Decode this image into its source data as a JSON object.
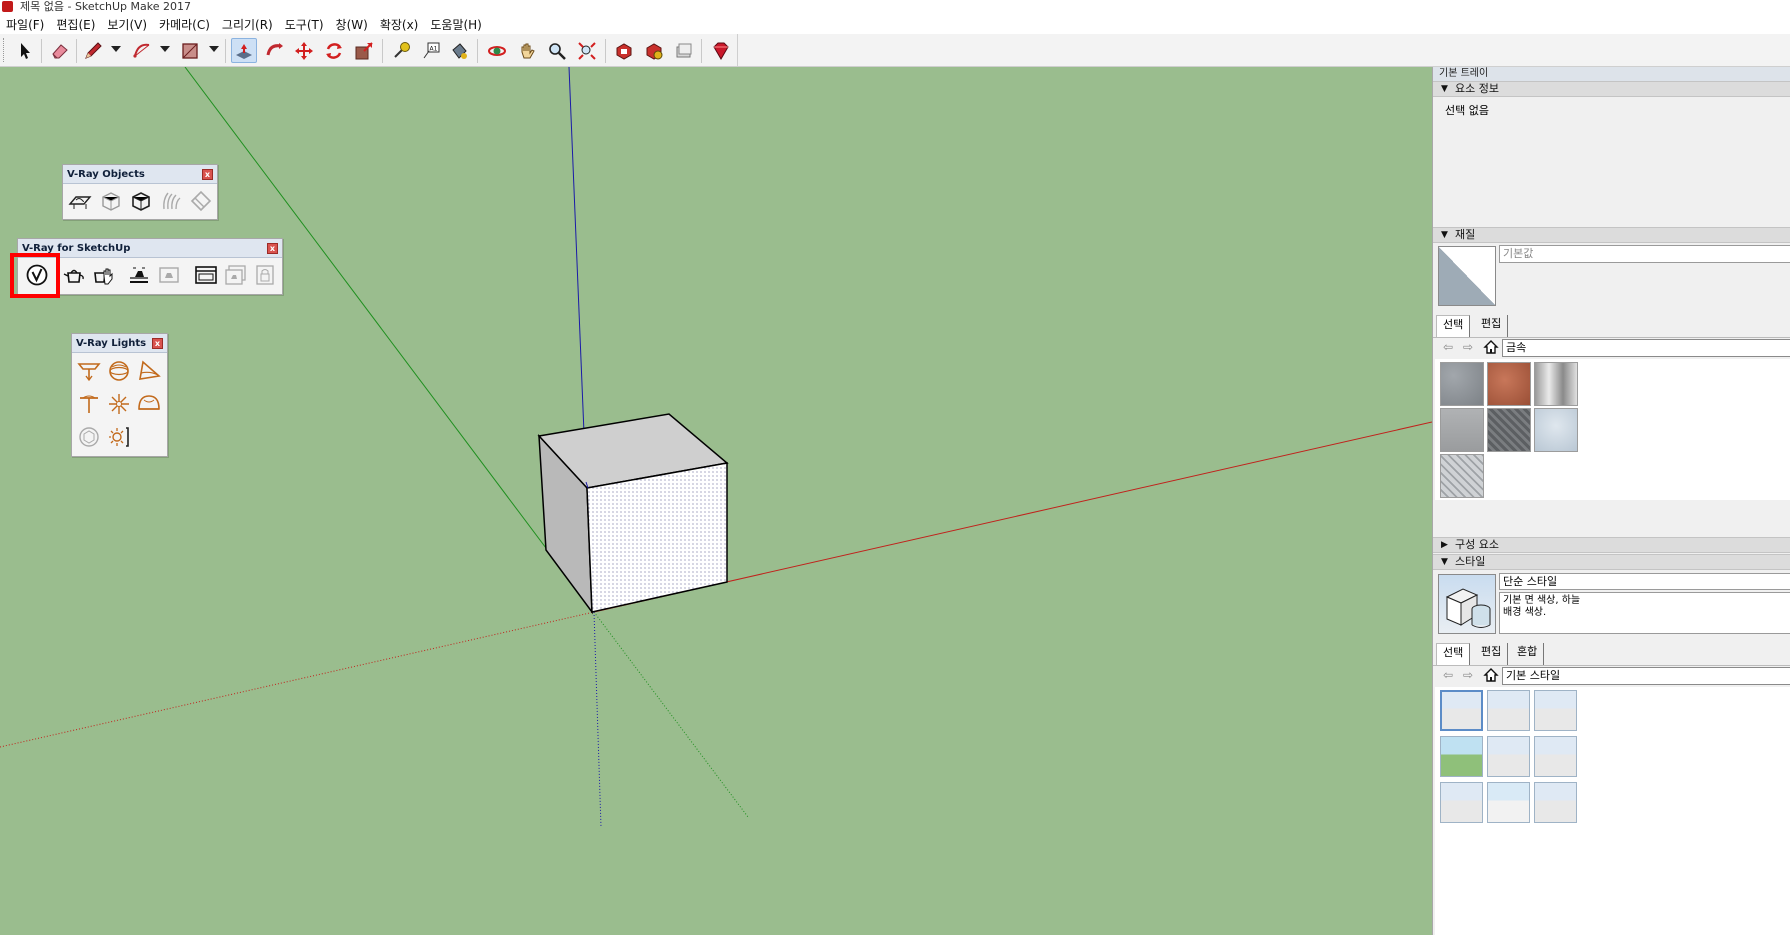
{
  "window": {
    "title": "제목 없음 - SketchUp Make 2017"
  },
  "menu": [
    "파일(F)",
    "편집(E)",
    "보기(V)",
    "카메라(C)",
    "그리기(R)",
    "도구(T)",
    "창(W)",
    "확장(x)",
    "도움말(H)"
  ],
  "toolbar": {
    "tools": [
      "select-tool",
      "eraser-tool",
      "line-tool",
      "arc-tool",
      "rectangle-tool",
      "push-pull-tool",
      "follow-me-tool",
      "move-tool",
      "rotate-tool",
      "scale-tool",
      "tape-measure-tool",
      "text-tool",
      "paint-bucket-tool",
      "orbit-tool",
      "pan-tool",
      "zoom-tool",
      "zoom-extents-tool",
      "3d-warehouse",
      "extension-warehouse",
      "layout",
      "ruby-extension-manager"
    ],
    "active_tool": "push-pull-tool"
  },
  "vray_objects": {
    "title": "V-Ray Objects",
    "close": "x"
  },
  "vray_sketchup": {
    "title": "V-Ray for SketchUp",
    "close": "x",
    "highlighted_icon": "vray-asset-editor-icon"
  },
  "vray_lights": {
    "title": "V-Ray Lights",
    "close": "x"
  },
  "tray": {
    "title": "기본 트레이",
    "entity_info": {
      "header": "요소 정보",
      "text": "선택 없음"
    },
    "materials": {
      "header": "재질",
      "name_placeholder": "기본값",
      "tabs": [
        "선택",
        "편집"
      ],
      "library": "금속",
      "swatch_colors": [
        "#8e9398",
        "#b5674a",
        "#c4c4c4",
        "#a3a5a7",
        "#6f7275",
        "#c9d4de",
        "#bfc3c7"
      ]
    },
    "components": {
      "header": "구성 요소"
    },
    "styles": {
      "header": "스타일",
      "style_name": "단순 스타일",
      "style_desc_line1": "기본 면 색상, 하늘",
      "style_desc_line2": "배경 색상.",
      "tabs": [
        "선택",
        "편집",
        "혼합"
      ],
      "library": "기본 스타일"
    }
  },
  "colors": {
    "viewport_bg": "#9ABD8E",
    "axis_red": "#c0221c",
    "axis_green": "#1f8f1f",
    "axis_blue": "#1a1aa8",
    "highlight": "#ff0000"
  }
}
